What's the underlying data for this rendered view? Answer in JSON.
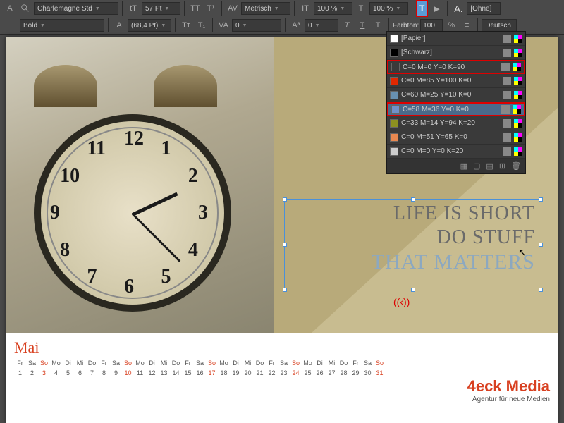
{
  "toolbar": {
    "row1": {
      "font_family": "Charlemagne Std",
      "font_size": "57 Pt",
      "kerning": "Metrisch",
      "hscale": "100 %",
      "vscale": "100 %",
      "char_style": "[Ohne]"
    },
    "row2": {
      "font_weight": "Bold",
      "leading": "(68,4 Pt)",
      "tracking": "0",
      "baseline": "0",
      "tint_label": "Farbton:",
      "tint_value": "100",
      "tint_unit": "%",
      "lang": "Deutsch"
    }
  },
  "swatches": {
    "items": [
      {
        "name": "[Papier]",
        "color": "#ffffff",
        "highlight": false,
        "selected": false
      },
      {
        "name": "[Schwarz]",
        "color": "#000000",
        "highlight": false,
        "selected": false
      },
      {
        "name": "C=0 M=0 Y=0 K=90",
        "color": "#3a3a3a",
        "highlight": true,
        "selected": false
      },
      {
        "name": "C=0 M=85 Y=100 K=0",
        "color": "#e02800",
        "highlight": false,
        "selected": false
      },
      {
        "name": "C=60 M=25 Y=10 K=0",
        "color": "#6890b0",
        "highlight": false,
        "selected": false
      },
      {
        "name": "C=58 M=36 Y=0 K=0",
        "color": "#7090c8",
        "highlight": true,
        "selected": true
      },
      {
        "name": "C=33 M=14 Y=94 K=20",
        "color": "#8c9020",
        "highlight": false,
        "selected": false
      },
      {
        "name": "C=0 M=51 Y=65 K=0",
        "color": "#e88850",
        "highlight": false,
        "selected": false
      },
      {
        "name": "C=0 M=0 Y=0 K=20",
        "color": "#cccccc",
        "highlight": false,
        "selected": false
      }
    ]
  },
  "document": {
    "quote_line1": "LIFE IS SHORT",
    "quote_line2": "DO STUFF",
    "quote_line3": "THAT MATTERS",
    "month": "Mai",
    "logo_name": "4eck Media",
    "logo_sub": "Agentur für neue Medien",
    "calendar": {
      "days": [
        "Fr",
        "Sa",
        "So",
        "Mo",
        "Di",
        "Mi",
        "Do",
        "Fr",
        "Sa",
        "So",
        "Mo",
        "Di",
        "Mi",
        "Do",
        "Fr",
        "Sa",
        "So",
        "Mo",
        "Di",
        "Mi",
        "Do",
        "Fr",
        "Sa",
        "So",
        "Mo",
        "Di",
        "Mi",
        "Do",
        "Fr",
        "Sa",
        "So"
      ],
      "nums": [
        "1",
        "2",
        "3",
        "4",
        "5",
        "6",
        "7",
        "8",
        "9",
        "10",
        "11",
        "12",
        "13",
        "14",
        "15",
        "16",
        "17",
        "18",
        "19",
        "20",
        "21",
        "22",
        "23",
        "24",
        "25",
        "26",
        "27",
        "28",
        "29",
        "30",
        "31"
      ]
    },
    "clock_numbers": [
      "12",
      "1",
      "2",
      "3",
      "4",
      "5",
      "6",
      "7",
      "8",
      "9",
      "10",
      "11"
    ]
  }
}
